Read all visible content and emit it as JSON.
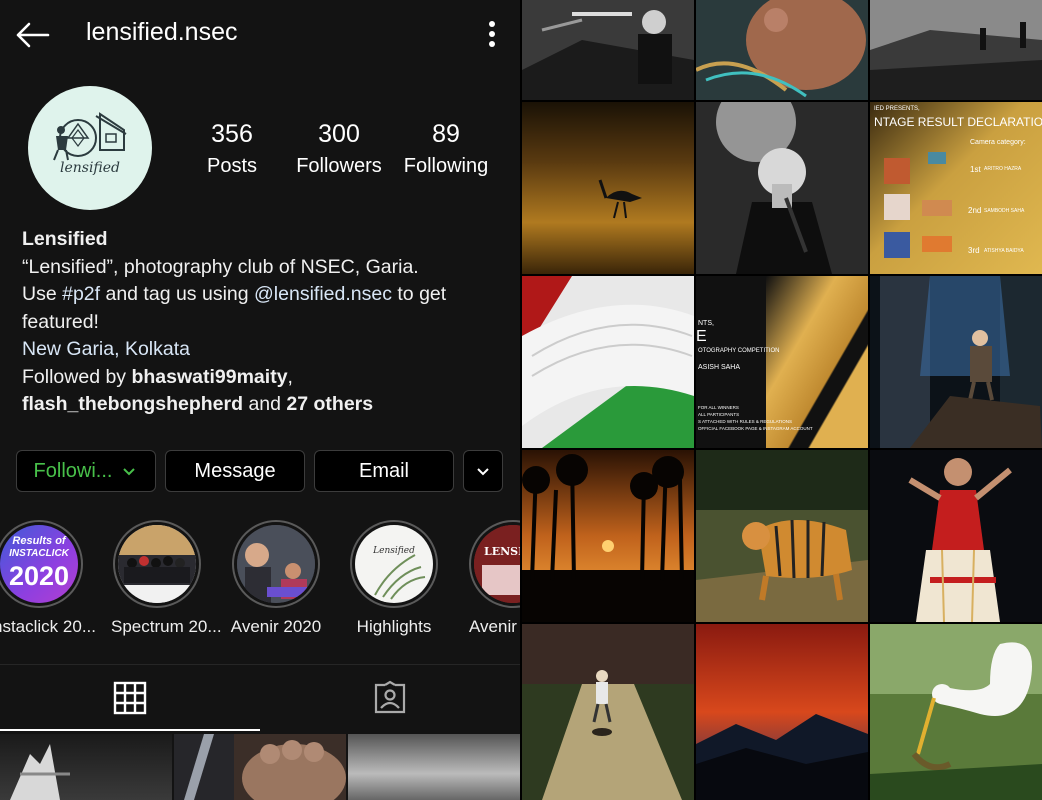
{
  "profile": {
    "username": "lensified.nsec",
    "avatar_text": "lensified",
    "stats": [
      {
        "value": "356",
        "label": "Posts"
      },
      {
        "value": "300",
        "label": "Followers"
      },
      {
        "value": "89",
        "label": "Following"
      }
    ],
    "bio": {
      "name": "Lensified",
      "line1": "“Lensified”, photography club of NSEC, Garia.",
      "line2_pre": "Use ",
      "hashtag": "#p2f",
      "line2_mid": " and tag us using ",
      "mention": "@lensified.nsec",
      "line2_post": " to get",
      "line3": "featured!",
      "location": "New Garia, Kolkata",
      "followed_by_prefix": "Followed by ",
      "follower1": "bhaswati99maity",
      "comma": ",",
      "follower2": "flash_thebongshepherd",
      "and_text": " and ",
      "others": "27 others"
    },
    "buttons": {
      "following": "Followi...",
      "message": "Message",
      "email": "Email"
    },
    "highlights": [
      {
        "label": "nstaclick 20...",
        "cover_text_top": "Results of",
        "cover_text_mid": "INSTACLICK",
        "cover_text_big": "2020"
      },
      {
        "label": "Spectrum 20..."
      },
      {
        "label": "Avenir 2020"
      },
      {
        "label": "Highlights",
        "cover_text": "Lensified"
      },
      {
        "label": "Avenir",
        "cover_text": "LENSIF"
      }
    ]
  },
  "posts": {
    "declaration_title": "NTAGE RESULT DECLARATION",
    "declaration_presents": "IED PRESENTS,",
    "declaration_category": "Camera category:",
    "declaration_places": [
      "1st",
      "2nd",
      "3rd"
    ],
    "declaration_names": [
      "ARITRO HAZRA",
      "SAMBODH SAHA",
      "ATISHYA BAIDYA"
    ],
    "comp_line1": "NTS,",
    "comp_big": "E",
    "comp_line2": "OTOGRAPHY COMPETITION",
    "comp_name": "ASISH SAHA",
    "comp_details": [
      "FOR ALL WINNERS",
      "ALL PARTICIPANTS",
      "S ATTACHED WITH RULES & REGULATIONS",
      "OFFICIAL FACEBOOK PAGE & INSTAGRAM ACCOUNT"
    ]
  },
  "colors": {
    "background": "#131313",
    "following_green": "#48c04a",
    "avatar_bg": "#dff3ec"
  }
}
